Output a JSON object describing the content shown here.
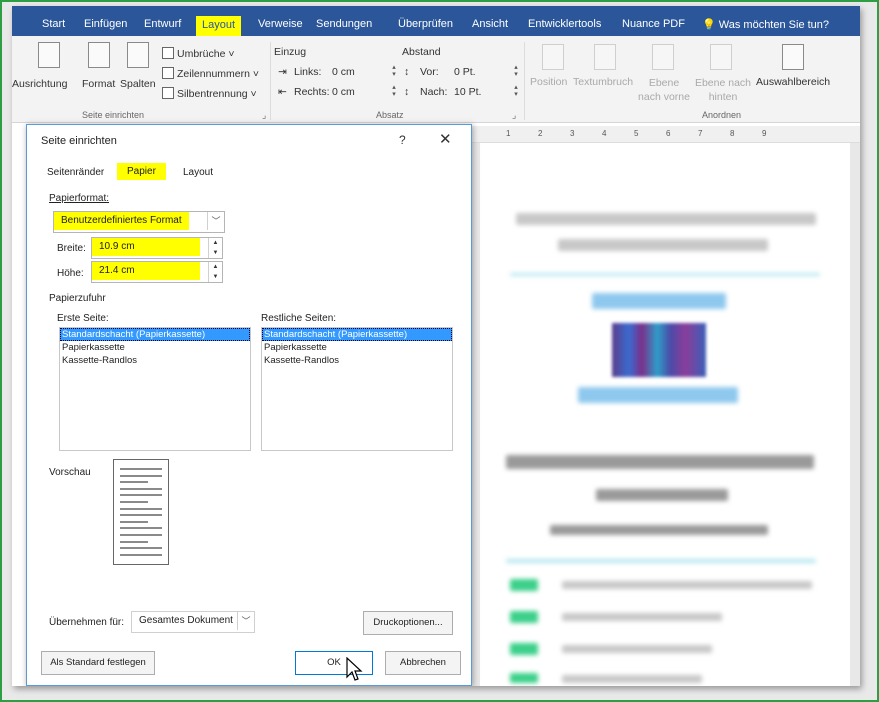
{
  "ribbon_tabs": {
    "start": "Start",
    "einfuegen": "Einfügen",
    "entwurf": "Entwurf",
    "layout": "Layout",
    "verweise": "Verweise",
    "sendungen": "Sendungen",
    "ueberpruefen": "Überprüfen",
    "ansicht": "Ansicht",
    "entwicklertools": "Entwicklertools",
    "nuance": "Nuance PDF",
    "tellme": "Was möchten Sie tun?"
  },
  "ribbon": {
    "ausrichtung": "Ausrichtung",
    "format": "Format",
    "spalten": "Spalten",
    "umbrueche": "Umbrüche ˅",
    "zeilennummern": "Zeilennummern ˅",
    "silbentrennung": "Silbentrennung ˅",
    "group_seite": "Seite einrichten",
    "einzug": "Einzug",
    "links_label": "Links:",
    "links_val": "0 cm",
    "rechts_label": "Rechts:",
    "rechts_val": "0 cm",
    "abstand": "Abstand",
    "vor_label": "Vor:",
    "vor_val": "0 Pt.",
    "nach_label": "Nach:",
    "nach_val": "10 Pt.",
    "group_absatz": "Absatz",
    "position": "Position",
    "textumbruch": "Textumbruch",
    "ebene_vorne": "Ebene nach vorne",
    "ebene_hinten": "Ebene nach hinten",
    "auswahlbereich": "Auswahlbereich",
    "group_anordnen": "Anordnen"
  },
  "ruler": {
    "ticks": [
      "1",
      "2",
      "3",
      "4",
      "5",
      "6",
      "7",
      "8",
      "9"
    ]
  },
  "dialog": {
    "title": "Seite einrichten",
    "help": "?",
    "close": "✕",
    "tabs": {
      "seitenraender": "Seitenränder",
      "papier": "Papier",
      "layout": "Layout"
    },
    "papierformat_label": "Papierformat:",
    "papierformat_value": "Benutzerdefiniertes Format",
    "breite_label": "Breite:",
    "breite_value": "10.9 cm",
    "hoehe_label": "Höhe:",
    "hoehe_value": "21.4 cm",
    "papierzufuhr": "Papierzufuhr",
    "erste_seite_label": "Erste Seite:",
    "restliche_label": "Restliche Seiten:",
    "erste_items": [
      "Standardschacht (Papierkassette)",
      "Papierkassette",
      "Kassette-Randlos"
    ],
    "restliche_items": [
      "Standardschacht (Papierkassette)",
      "Papierkassette",
      "Kassette-Randlos"
    ],
    "vorschau": "Vorschau",
    "uebernehmen_label": "Übernehmen für:",
    "uebernehmen_value": "Gesamtes Dokument",
    "druckoptionen": "Druckoptionen...",
    "als_standard": "Als Standard festlegen",
    "ok": "OK",
    "abbrechen": "Abbrechen"
  },
  "colors": {
    "tabbar": "#2b579a",
    "highlight": "#ffff00",
    "selection": "#3399ff",
    "frame": "#2e9e44"
  }
}
